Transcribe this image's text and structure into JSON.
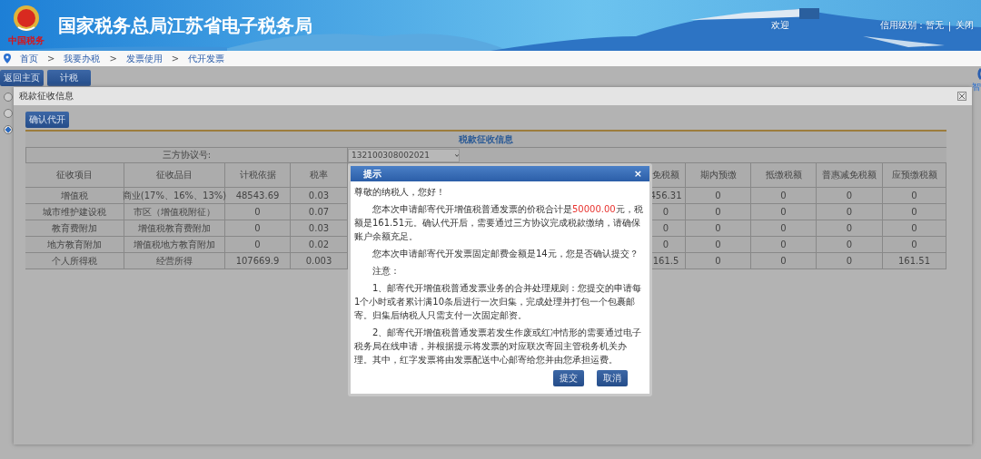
{
  "header": {
    "title": "国家税务总局江苏省电子税务局",
    "logo_text": "中国税务",
    "welcome": "欢迎",
    "credit": "信用级别：暂无",
    "separator": "|",
    "close": "关闭"
  },
  "breadcrumb": [
    "首页",
    "我要办税",
    "发票使用",
    "代开发票"
  ],
  "breadcrumb_separator": ">",
  "side_helper": {
    "label": "智"
  },
  "toolbar": [
    "返回主页",
    "计税"
  ],
  "background_radios": [
    {
      "selected": false
    },
    {
      "selected": false
    },
    {
      "selected": true
    }
  ],
  "panel": {
    "title": "税款征收信息",
    "confirm_button": "确认代开",
    "table": {
      "title": "税款征收信息",
      "agreement_label": "三方协议号:",
      "agreement_value": "132100308002021",
      "columns": [
        "征收项目",
        "征收品目",
        "计税依据",
        "税率",
        "",
        "免税额",
        "期内预缴",
        "抵缴税额",
        "普惠减免税额",
        "应预缴税额"
      ],
      "rows": [
        [
          "增值税",
          "商业(17%、16%、13%)",
          "48543.69",
          "0.03",
          "",
          "456.31",
          "0",
          "0",
          "0",
          "0"
        ],
        [
          "城市维护建设税",
          "市区（增值税附征）",
          "0",
          "0.07",
          "",
          "0",
          "0",
          "0",
          "0",
          "0"
        ],
        [
          "教育费附加",
          "增值税教育费附加",
          "0",
          "0.03",
          "",
          "0",
          "0",
          "0",
          "0",
          "0"
        ],
        [
          "地方教育附加",
          "增值税地方教育附加",
          "0",
          "0.02",
          "",
          "0",
          "0",
          "0",
          "0",
          "0"
        ],
        [
          "个人所得税",
          "经营所得",
          "107669.9",
          "0.003",
          "",
          "161.5",
          "0",
          "0",
          "0",
          "161.51"
        ]
      ]
    }
  },
  "dialog": {
    "title": "提示",
    "close": "×",
    "greeting": "尊敬的纳税人，您好！",
    "amount_paragraph": {
      "before": "您本次申请邮寄代开增值税普通发票的价税合计是",
      "amount": "50000.00",
      "after": "元，税额是161.51元。确认代开后，需要通过三方协议完成税款缴纳，请确保账户余额充足。"
    },
    "postage": "您本次申请邮寄代开发票固定邮费金额是14元，您是否确认提交？",
    "note_label": "注意：",
    "notes": [
      "1、邮寄代开增值税普通发票业务的合并处理规则：您提交的申请每1个小时或者累计满10条后进行一次归集，完成处理并打包一个包裹邮寄。归集后纳税人只需支付一次固定邮资。",
      "2、邮寄代开增值税普通发票若发生作废或红冲情形的需要通过电子税务局在线申请，并根据提示将发票的对应联次寄回主管税务机关办理。其中，红字发票将由发票配送中心邮寄给您并由您承担运费。"
    ],
    "buttons": [
      "提交",
      "取消"
    ]
  }
}
